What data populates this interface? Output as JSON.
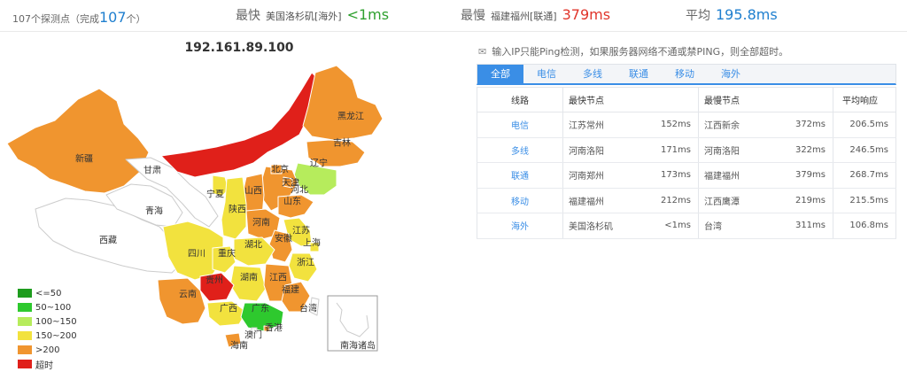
{
  "summary": {
    "probe_count_prefix": "107个探测点（完成",
    "probe_count_done": "107",
    "probe_count_suffix": "个）",
    "fastest_label": "最快",
    "fastest_node": "美国洛杉矶[海外]",
    "fastest_value": "<1ms",
    "slowest_label": "最慢",
    "slowest_node": "福建福州[联通]",
    "slowest_value": "379ms",
    "average_label": "平均",
    "average_value": "195.8ms"
  },
  "map": {
    "ip_title": "192.161.89.100",
    "colors": {
      "red": "#e0201a",
      "orange": "#f0952f",
      "yellow": "#f2e23e",
      "lightgreen": "#b6ec5c",
      "green": "#2ec92e",
      "white": "#ffffff"
    },
    "provinces": {
      "xinjiang": "新疆",
      "gansu": "甘肃",
      "qinghai": "青海",
      "xizang": "西藏",
      "heilongjiang": "黑龙江",
      "jilin": "吉林",
      "liaoning": "辽宁",
      "beijing": "北京",
      "hebei": "河北",
      "tianjin": "天津",
      "shanxi": "山西",
      "ningxia": "宁夏",
      "shaanxi": "陕西",
      "shandong": "山东",
      "henan": "河南",
      "jiangsu": "江苏",
      "anhui": "安徽",
      "shanghai": "上海",
      "hubei": "湖北",
      "sichuan": "四川",
      "chongqing": "重庆",
      "zhejiang": "浙江",
      "hunan": "湖南",
      "jiangxi": "江西",
      "yunnan": "云南",
      "guizhou": "贵州",
      "fujian": "福建",
      "guangxi": "广西",
      "guangdong": "广东",
      "taiwan": "台湾",
      "xianggang": "香港",
      "aomen": "澳门",
      "hainan": "海南",
      "nanhai": "南海诸岛"
    }
  },
  "legend": [
    {
      "label": "<=50",
      "color": "#1e9c1e"
    },
    {
      "label": "50~100",
      "color": "#2ec92e"
    },
    {
      "label": "100~150",
      "color": "#b6ec5c"
    },
    {
      "label": "150~200",
      "color": "#f2e23e"
    },
    {
      "label": ">200",
      "color": "#f0952f"
    },
    {
      "label": "超时",
      "color": "#e0201a"
    }
  ],
  "notice": "输入IP只能Ping检测，如果服务器网络不通或禁PING，则全部超时。",
  "tabs": [
    "全部",
    "电信",
    "多线",
    "联通",
    "移动",
    "海外"
  ],
  "table": {
    "headers": {
      "line": "线路",
      "fastest": "最快节点",
      "slowest": "最慢节点",
      "avg": "平均响应"
    },
    "rows": [
      {
        "line": "电信",
        "fast_node": "江苏常州",
        "fast_time": "152ms",
        "slow_node": "江西新余",
        "slow_time": "372ms",
        "avg": "206.5ms"
      },
      {
        "line": "多线",
        "fast_node": "河南洛阳",
        "fast_time": "171ms",
        "slow_node": "河南洛阳",
        "slow_time": "322ms",
        "avg": "246.5ms"
      },
      {
        "line": "联通",
        "fast_node": "河南郑州",
        "fast_time": "173ms",
        "slow_node": "福建福州",
        "slow_time": "379ms",
        "avg": "268.7ms"
      },
      {
        "line": "移动",
        "fast_node": "福建福州",
        "fast_time": "212ms",
        "slow_node": "江西鹰潭",
        "slow_time": "219ms",
        "avg": "215.5ms"
      },
      {
        "line": "海外",
        "fast_node": "美国洛杉矶",
        "fast_time": "<1ms",
        "slow_node": "台湾",
        "slow_time": "311ms",
        "avg": "106.8ms"
      }
    ]
  }
}
